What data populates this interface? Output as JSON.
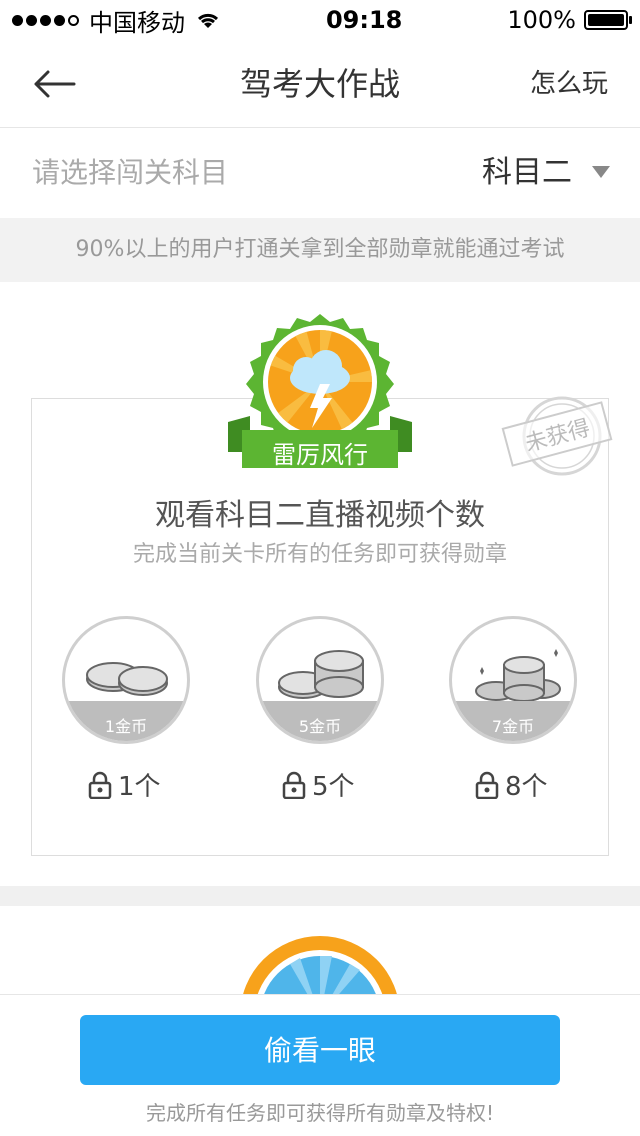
{
  "status_bar": {
    "carrier": "中国移动",
    "time": "09:18",
    "battery": "100%"
  },
  "header": {
    "title": "驾考大作战",
    "help": "怎么玩"
  },
  "selector": {
    "label": "请选择闯关科目",
    "value": "科目二"
  },
  "notice": "90%以上的用户打通关拿到全部勋章就能通过考试",
  "badge": {
    "name": "雷厉风行",
    "status": "未获得"
  },
  "task": {
    "title": "观看科目二直播视频个数",
    "subtitle": "完成当前关卡所有的任务即可获得勋章"
  },
  "rewards": [
    {
      "coins": "1金币",
      "requirement": "1个"
    },
    {
      "coins": "5金币",
      "requirement": "5个"
    },
    {
      "coins": "7金币",
      "requirement": "8个"
    }
  ],
  "footer": {
    "button": "偷看一眼",
    "note": "完成所有任务即可获得所有勋章及特权!"
  },
  "colors": {
    "accent": "#29a8f3",
    "badge_green": "#5cb532",
    "badge_orange": "#f7a21b"
  }
}
